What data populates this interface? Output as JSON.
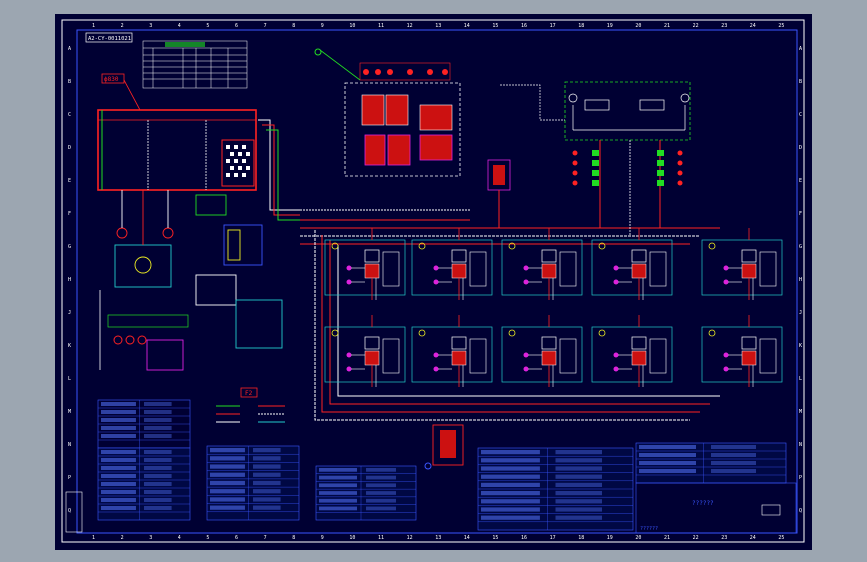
{
  "drawing": {
    "title_tag": "A2-CY-0011021",
    "tank_label": "ϕ830",
    "code_label": "F2",
    "colors": {
      "sheet": "#000033",
      "frame": "#ffffff",
      "accent_blue": "#3333ff",
      "pipe_red": "#ff2222",
      "pipe_white": "#ffffff",
      "comp_green": "#22dd22",
      "comp_cyan": "#22cccc",
      "comp_magenta": "#dd22dd",
      "comp_yellow": "#eeee22",
      "table_blue": "#2233dd"
    },
    "border_numbers": [
      "1",
      "2",
      "3",
      "4",
      "5",
      "6",
      "7",
      "8",
      "9",
      "10",
      "11",
      "12",
      "13",
      "14",
      "15",
      "16",
      "17",
      "18",
      "19",
      "20",
      "21",
      "22",
      "23",
      "24",
      "25"
    ],
    "border_letters": [
      "A",
      "B",
      "C",
      "D",
      "E",
      "F",
      "G",
      "H",
      "J",
      "K",
      "L",
      "M",
      "N",
      "P",
      "Q"
    ],
    "scheme_label": "??????",
    "title_block_text": "??????"
  }
}
